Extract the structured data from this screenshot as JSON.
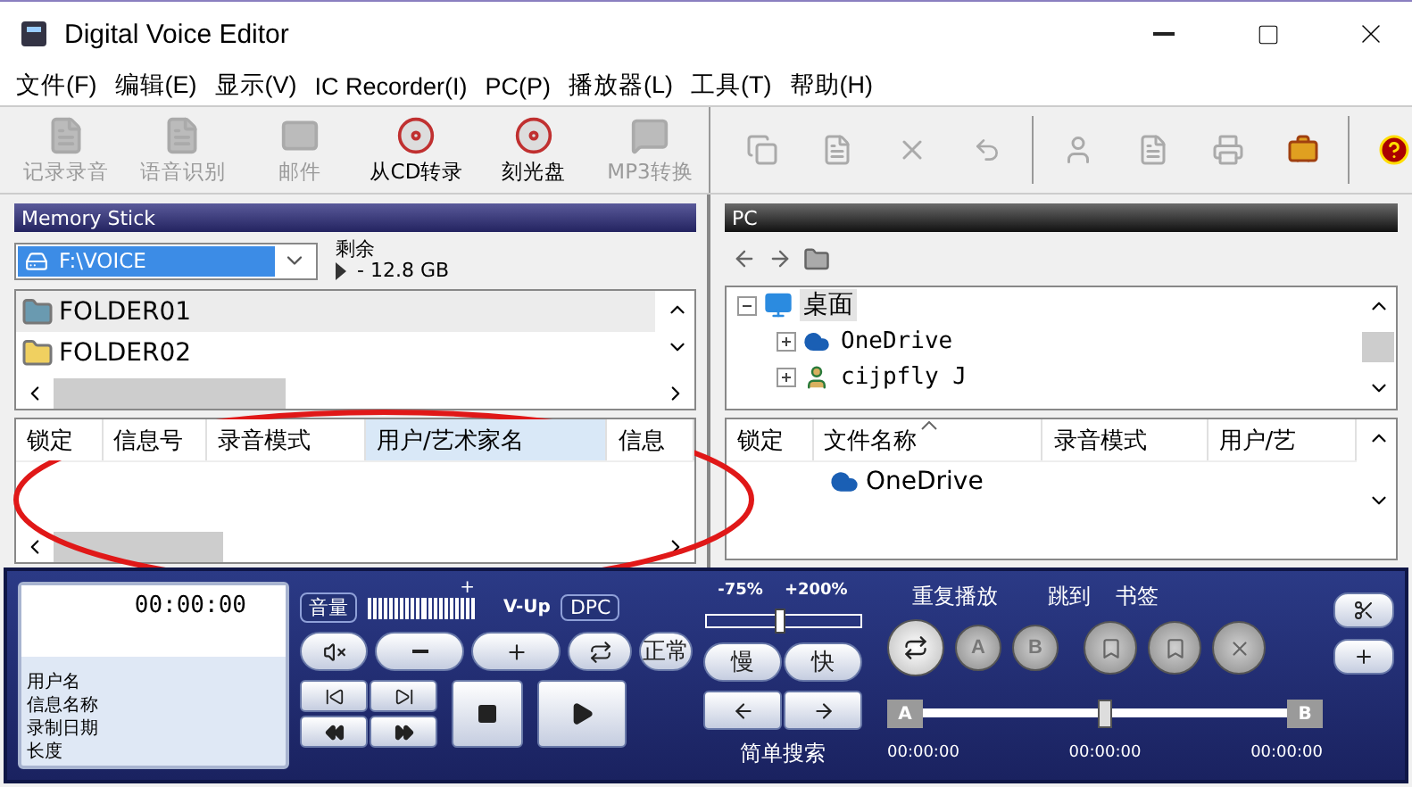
{
  "window": {
    "title": "Digital Voice Editor"
  },
  "menu": [
    "文件(F)",
    "编辑(E)",
    "显示(V)",
    "IC Recorder(I)",
    "PC(P)",
    "播放器(L)",
    "工具(T)",
    "帮助(H)"
  ],
  "toolbar": [
    {
      "label": "记录录音",
      "disabled": true
    },
    {
      "label": "语音识别",
      "disabled": true
    },
    {
      "label": "邮件",
      "disabled": true
    },
    {
      "label": "从CD转录",
      "disabled": false
    },
    {
      "label": "刻光盘",
      "disabled": false
    },
    {
      "label": "MP3转换",
      "disabled": true
    }
  ],
  "memory_stick": {
    "title": "Memory Stick",
    "drive": "F:\\VOICE",
    "free_label": "剩余",
    "free_value": "- 12.8 GB",
    "folders": [
      {
        "name": "FOLDER01",
        "selected": true
      },
      {
        "name": "FOLDER02",
        "selected": false
      }
    ],
    "columns": [
      {
        "label": "锁定",
        "selected": false
      },
      {
        "label": "信息号",
        "selected": false
      },
      {
        "label": "录音模式",
        "selected": false
      },
      {
        "label": "用户/艺术家名",
        "selected": true
      },
      {
        "label": "信息",
        "selected": false
      }
    ]
  },
  "pc": {
    "title": "PC",
    "tree": [
      {
        "label": "桌面",
        "expanded": true,
        "selected": true,
        "children": [
          {
            "label": "OneDrive",
            "expanded": false
          },
          {
            "label": "cijpfly J",
            "expanded": false
          }
        ]
      }
    ],
    "columns": [
      {
        "label": "锁定",
        "sorted": false
      },
      {
        "label": "文件名称",
        "sorted": true
      },
      {
        "label": "录音模式",
        "sorted": false
      },
      {
        "label": "用户/艺",
        "sorted": false
      }
    ],
    "rows": [
      {
        "name": "OneDrive"
      }
    ]
  },
  "player": {
    "time": "00:00:00",
    "info_labels": [
      "用户名",
      "信息名称",
      "录制日期",
      "长度"
    ],
    "volume_label": "音量",
    "volume": {
      "level": 1,
      "max_mark": "+"
    },
    "vup_label": "V-Up",
    "dpc_label": "DPC",
    "normal": "正常",
    "speed": {
      "min": "-75%",
      "max": "+200%",
      "level": 0.48
    },
    "slow": "慢",
    "fast": "快",
    "search_label": "简单搜索",
    "repeat_label": "重复播放",
    "a": "A",
    "b": "B",
    "jump_label": "跳到",
    "bookmark_label": "书签",
    "track": {
      "start": "A",
      "end": "B",
      "level": 0.5,
      "times": [
        "00:00:00",
        "00:00:00",
        "00:00:00"
      ]
    }
  }
}
